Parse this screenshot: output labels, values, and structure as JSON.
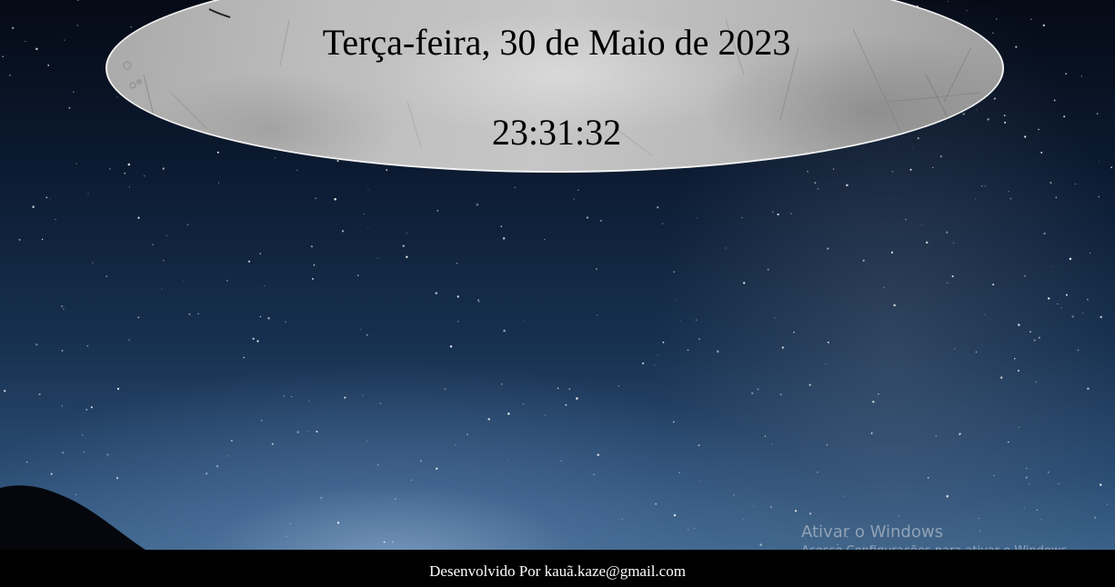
{
  "clock": {
    "date": "Terça-feira, 30 de Maio de 2023",
    "time": "23:31:32"
  },
  "footer": {
    "credit": "Desenvolvido Por kauã.kaze@gmail.com"
  },
  "windows_activation": {
    "title": "Ativar o Windows",
    "subtitle": "Acesse Configurações para ativar o Windows."
  },
  "colors": {
    "sky_top": "#050a16",
    "sky_bottom": "#3a6288",
    "panel": "#bdbdbd",
    "footer_bg": "#000000",
    "footer_text": "#ffffff"
  }
}
